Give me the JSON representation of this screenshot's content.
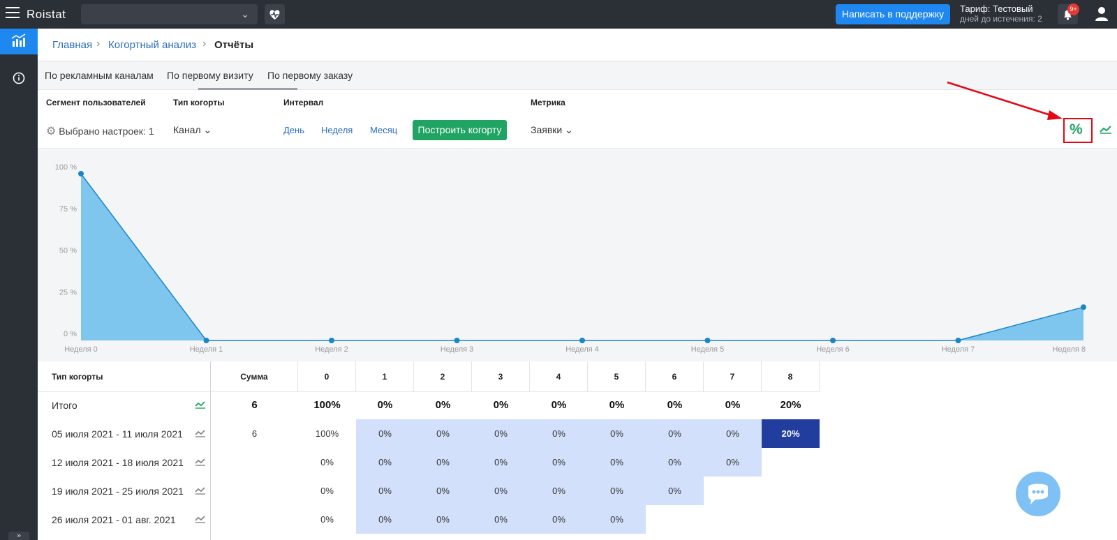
{
  "topbar": {
    "logo": "Roistat",
    "support_button": "Написать в поддержку",
    "tariff_title": "Тариф: Тестовый",
    "tariff_sub": "дней до истечения: 2",
    "bell_badge": "9+"
  },
  "breadcrumb": [
    "Главная",
    "Когортный анализ",
    "Отчёты"
  ],
  "tabs": [
    "По рекламным каналам",
    "По первому визиту",
    "По первому заказу"
  ],
  "active_tab": "По первому визиту",
  "filters": {
    "segment_label": "Сегмент пользователей",
    "segment_value": "Выбрано настроек: 1",
    "type_label": "Тип когорты",
    "type_value": "Канал",
    "interval_label": "Интервал",
    "interval_options": [
      "День",
      "Неделя",
      "Месяц"
    ],
    "build_button": "Построить когорту",
    "metric_label": "Метрика",
    "metric_value": "Заявки",
    "percent_symbol": "%"
  },
  "chart_data": {
    "type": "area",
    "x": [
      "Неделя 0",
      "Неделя 1",
      "Неделя 2",
      "Неделя 3",
      "Неделя 4",
      "Неделя 5",
      "Неделя 6",
      "Неделя 7",
      "Неделя 8"
    ],
    "values": [
      100,
      0,
      0,
      0,
      0,
      0,
      0,
      0,
      20
    ],
    "yticks": [
      "100 %",
      "75 %",
      "50 %",
      "25 %",
      "0 %"
    ],
    "ylim": [
      0,
      100
    ],
    "color": "#7fc6ef",
    "line_color": "#1a86c8"
  },
  "table": {
    "headers": [
      "Тип когорты",
      "Сумма",
      "0",
      "1",
      "2",
      "3",
      "4",
      "5",
      "6",
      "7",
      "8"
    ],
    "total": {
      "label": "Итого",
      "sum": "6",
      "cells": [
        "100%",
        "0%",
        "0%",
        "0%",
        "0%",
        "0%",
        "0%",
        "0%",
        "20%"
      ]
    },
    "rows": [
      {
        "label": "05 июля 2021 - 11 июля 2021",
        "sum": "6",
        "cells": [
          "100%",
          "0%",
          "0%",
          "0%",
          "0%",
          "0%",
          "0%",
          "0%",
          "20%"
        ]
      },
      {
        "label": "12 июля 2021 - 18 июля 2021",
        "sum": "",
        "cells": [
          "0%",
          "0%",
          "0%",
          "0%",
          "0%",
          "0%",
          "0%",
          "0%"
        ]
      },
      {
        "label": "19 июля 2021 - 25 июля 2021",
        "sum": "",
        "cells": [
          "0%",
          "0%",
          "0%",
          "0%",
          "0%",
          "0%",
          "0%"
        ]
      },
      {
        "label": "26 июля 2021 - 01 авг. 2021",
        "sum": "",
        "cells": [
          "0%",
          "0%",
          "0%",
          "0%",
          "0%",
          "0%"
        ]
      }
    ]
  }
}
